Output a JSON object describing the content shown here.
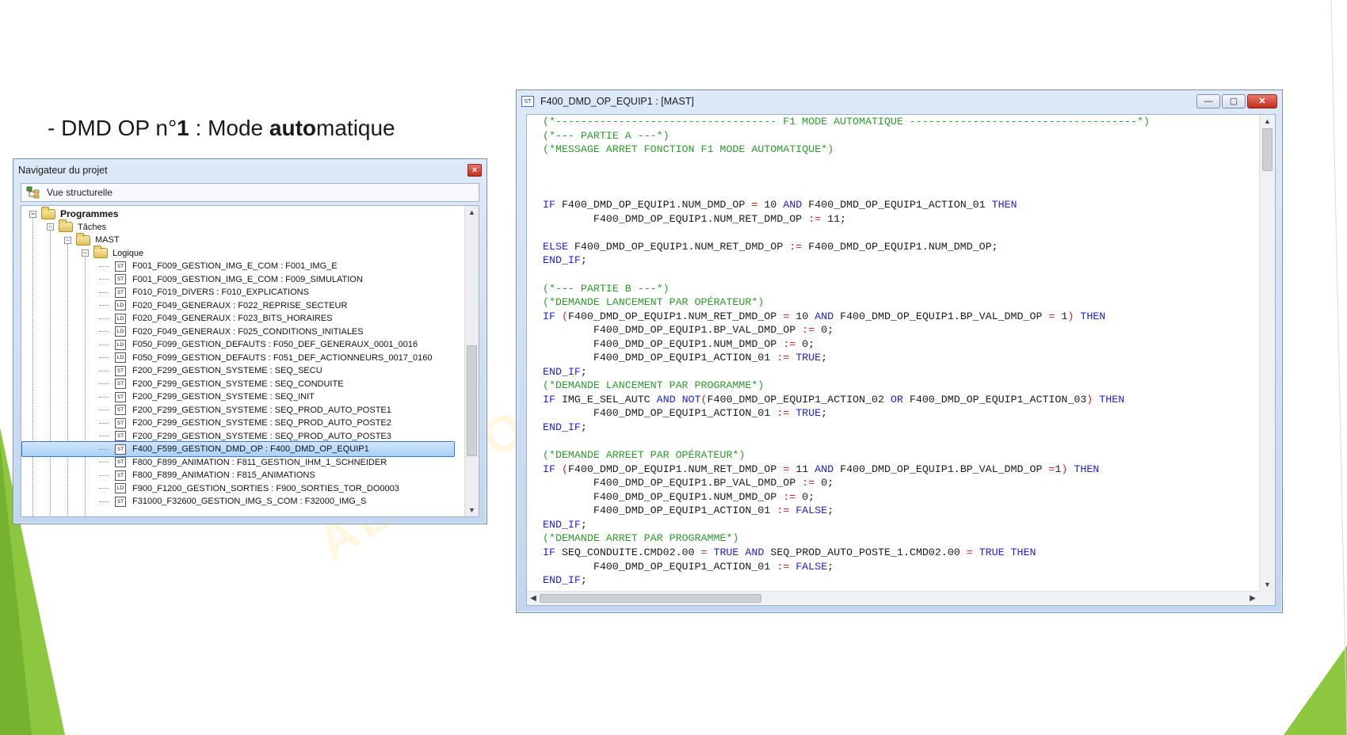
{
  "slide": {
    "title_prefix": "- DMD OP n°",
    "title_num": "1",
    "title_mid": " : Mode ",
    "title_bold": "auto",
    "title_suffix": "matique",
    "watermark": "AEI · FOR"
  },
  "navigator": {
    "title": "Navigateur du projet",
    "close_glyph": "×",
    "toolbar_label": "Vue structurelle",
    "tree": [
      {
        "level": 0,
        "type": "folder",
        "label": "Programmes",
        "bold": true
      },
      {
        "level": 1,
        "type": "folder",
        "label": "Tâches"
      },
      {
        "level": 2,
        "type": "folder",
        "label": "MAST"
      },
      {
        "level": 3,
        "type": "folder",
        "label": "Logique"
      },
      {
        "level": 4,
        "type": "ST",
        "label": "F001_F009_GESTION_IMG_E_COM : F001_IMG_E"
      },
      {
        "level": 4,
        "type": "ST",
        "label": "F001_F009_GESTION_IMG_E_COM : F009_SIMULATION"
      },
      {
        "level": 4,
        "type": "ST",
        "label": "F010_F019_DIVERS : F010_EXPLICATIONS"
      },
      {
        "level": 4,
        "type": "LD",
        "label": "F020_F049_GENERAUX : F022_REPRISE_SECTEUR"
      },
      {
        "level": 4,
        "type": "LD",
        "label": "F020_F049_GENERAUX : F023_BITS_HORAIRES"
      },
      {
        "level": 4,
        "type": "LD",
        "label": "F020_F049_GENERAUX : F025_CONDITIONS_INITIALES"
      },
      {
        "level": 4,
        "type": "LD",
        "label": "F050_F099_GESTION_DEFAUTS : F050_DEF_GENERAUX_0001_0016"
      },
      {
        "level": 4,
        "type": "LD",
        "label": "F050_F099_GESTION_DEFAUTS : F051_DEF_ACTIONNEURS_0017_0160"
      },
      {
        "level": 4,
        "type": "ST",
        "label": "F200_F299_GESTION_SYSTEME : SEQ_SECU"
      },
      {
        "level": 4,
        "type": "ST",
        "label": "F200_F299_GESTION_SYSTEME : SEQ_CONDUITE"
      },
      {
        "level": 4,
        "type": "ST",
        "label": "F200_F299_GESTION_SYSTEME : SEQ_INIT"
      },
      {
        "level": 4,
        "type": "ST",
        "label": "F200_F299_GESTION_SYSTEME : SEQ_PROD_AUTO_POSTE1"
      },
      {
        "level": 4,
        "type": "ST",
        "label": "F200_F299_GESTION_SYSTEME : SEQ_PROD_AUTO_POSTE2"
      },
      {
        "level": 4,
        "type": "ST",
        "label": "F200_F299_GESTION_SYSTEME : SEQ_PROD_AUTO_POSTE3"
      },
      {
        "level": 4,
        "type": "ST",
        "label": "F400_F599_GESTION_DMD_OP : F400_DMD_OP_EQUIP1",
        "selected": true
      },
      {
        "level": 4,
        "type": "ST",
        "label": "F800_F899_ANIMATION : F811_GESTION_IHM_1_SCHNEIDER"
      },
      {
        "level": 4,
        "type": "ST",
        "label": "F800_F899_ANIMATION : F815_ANIMATIONS"
      },
      {
        "level": 4,
        "type": "LD",
        "label": "F900_F1200_GESTION_SORTIES : F900_SORTIES_TOR_DO0003"
      },
      {
        "level": 4,
        "type": "ST",
        "label": "F31000_F32600_GESTION_IMG_S_COM : F32000_IMG_S"
      }
    ]
  },
  "editor": {
    "icon_text": "ST",
    "title": "F400_DMD_OP_EQUIP1 : [MAST]",
    "minimize_glyph": "—",
    "maximize_glyph": "▢",
    "close_glyph": "✕",
    "code_lines": [
      [
        [
          "cm",
          "(*----------------------------------- F1 MODE AUTOMATIQUE ------------------------------------*)"
        ]
      ],
      [
        [
          "cm",
          "(*--- PARTIE A ---*)"
        ]
      ],
      [
        [
          "cm",
          "(*MESSAGE ARRET FONCTION F1 MODE AUTOMATIQUE*)"
        ]
      ],
      [],
      [],
      [],
      [
        [
          "kw",
          "IF"
        ],
        [
          "nm",
          " F400_DMD_OP_EQUIP1.NUM_DMD_OP "
        ],
        [
          "op",
          "="
        ],
        [
          "nm",
          " 10 "
        ],
        [
          "kw",
          "AND"
        ],
        [
          "nm",
          " F400_DMD_OP_EQUIP1_ACTION_01 "
        ],
        [
          "kw",
          "THEN"
        ]
      ],
      [
        [
          "nm",
          "        F400_DMD_OP_EQUIP1.NUM_RET_DMD_OP "
        ],
        [
          "op",
          ":="
        ],
        [
          "nm",
          " 11;"
        ]
      ],
      [],
      [
        [
          "kw",
          "ELSE"
        ],
        [
          "nm",
          " F400_DMD_OP_EQUIP1.NUM_RET_DMD_OP "
        ],
        [
          "op",
          ":="
        ],
        [
          "nm",
          " F400_DMD_OP_EQUIP1.NUM_DMD_OP;"
        ]
      ],
      [
        [
          "kw",
          "END_IF"
        ],
        [
          "nm",
          ";"
        ]
      ],
      [],
      [
        [
          "cm",
          "(*--- PARTIE B ---*)"
        ]
      ],
      [
        [
          "cm",
          "(*DEMANDE LANCEMENT PAR OPÉRATEUR*)"
        ]
      ],
      [
        [
          "kw",
          "IF"
        ],
        [
          "nm",
          " "
        ],
        [
          "op",
          "("
        ],
        [
          "nm",
          "F400_DMD_OP_EQUIP1.NUM_RET_DMD_OP "
        ],
        [
          "op",
          "="
        ],
        [
          "nm",
          " 10 "
        ],
        [
          "kw",
          "AND"
        ],
        [
          "nm",
          " F400_DMD_OP_EQUIP1.BP_VAL_DMD_OP "
        ],
        [
          "op",
          "="
        ],
        [
          "nm",
          " 1"
        ],
        [
          "op",
          ")"
        ],
        [
          "nm",
          " "
        ],
        [
          "kw",
          "THEN"
        ]
      ],
      [
        [
          "nm",
          "        F400_DMD_OP_EQUIP1.BP_VAL_DMD_OP "
        ],
        [
          "op",
          ":="
        ],
        [
          "nm",
          " 0;"
        ]
      ],
      [
        [
          "nm",
          "        F400_DMD_OP_EQUIP1.NUM_DMD_OP "
        ],
        [
          "op",
          ":="
        ],
        [
          "nm",
          " 0;"
        ]
      ],
      [
        [
          "nm",
          "        F400_DMD_OP_EQUIP1_ACTION_01 "
        ],
        [
          "op",
          ":="
        ],
        [
          "nm",
          " "
        ],
        [
          "kw",
          "TRUE"
        ],
        [
          "nm",
          ";"
        ]
      ],
      [
        [
          "kw",
          "END_IF"
        ],
        [
          "nm",
          ";"
        ]
      ],
      [
        [
          "cm",
          "(*DEMANDE LANCEMENT PAR PROGRAMME*)"
        ]
      ],
      [
        [
          "kw",
          "IF"
        ],
        [
          "nm",
          " IMG_E_SEL_AUTC "
        ],
        [
          "kw",
          "AND"
        ],
        [
          "nm",
          " "
        ],
        [
          "kw",
          "NOT"
        ],
        [
          "op",
          "("
        ],
        [
          "nm",
          "F400_DMD_OP_EQUIP1_ACTION_02 "
        ],
        [
          "kw",
          "OR"
        ],
        [
          "nm",
          " F400_DMD_OP_EQUIP1_ACTION_03"
        ],
        [
          "op",
          ")"
        ],
        [
          "nm",
          " "
        ],
        [
          "kw",
          "THEN"
        ]
      ],
      [
        [
          "nm",
          "        F400_DMD_OP_EQUIP1_ACTION_01 "
        ],
        [
          "op",
          ":="
        ],
        [
          "nm",
          " "
        ],
        [
          "kw",
          "TRUE"
        ],
        [
          "nm",
          ";"
        ]
      ],
      [
        [
          "kw",
          "END_IF"
        ],
        [
          "nm",
          ";"
        ]
      ],
      [],
      [
        [
          "cm",
          "(*DEMANDE ARREET PAR OPÉRATEUR*)"
        ]
      ],
      [
        [
          "kw",
          "IF"
        ],
        [
          "nm",
          " "
        ],
        [
          "op",
          "("
        ],
        [
          "nm",
          "F400_DMD_OP_EQUIP1.NUM_RET_DMD_OP "
        ],
        [
          "op",
          "="
        ],
        [
          "nm",
          " 11 "
        ],
        [
          "kw",
          "AND"
        ],
        [
          "nm",
          " F400_DMD_OP_EQUIP1.BP_VAL_DMD_OP "
        ],
        [
          "op",
          "="
        ],
        [
          "nm",
          "1"
        ],
        [
          "op",
          ")"
        ],
        [
          "nm",
          " "
        ],
        [
          "kw",
          "THEN"
        ]
      ],
      [
        [
          "nm",
          "        F400_DMD_OP_EQUIP1.BP_VAL_DMD_OP "
        ],
        [
          "op",
          ":="
        ],
        [
          "nm",
          " 0;"
        ]
      ],
      [
        [
          "nm",
          "        F400_DMD_OP_EQUIP1.NUM_DMD_OP "
        ],
        [
          "op",
          ":="
        ],
        [
          "nm",
          " 0;"
        ]
      ],
      [
        [
          "nm",
          "        F400_DMD_OP_EQUIP1_ACTION_01 "
        ],
        [
          "op",
          ":="
        ],
        [
          "nm",
          " "
        ],
        [
          "kw",
          "FALSE"
        ],
        [
          "nm",
          ";"
        ]
      ],
      [
        [
          "kw",
          "END_IF"
        ],
        [
          "nm",
          ";"
        ]
      ],
      [
        [
          "cm",
          "(*DEMANDE ARRET PAR PROGRAMME*)"
        ]
      ],
      [
        [
          "kw",
          "IF"
        ],
        [
          "nm",
          " SEQ_CONDUITE.CMD02.00 "
        ],
        [
          "op",
          "="
        ],
        [
          "nm",
          " "
        ],
        [
          "kw",
          "TRUE"
        ],
        [
          "nm",
          " "
        ],
        [
          "kw",
          "AND"
        ],
        [
          "nm",
          " SEQ_PROD_AUTO_POSTE_1.CMD02.00 "
        ],
        [
          "op",
          "="
        ],
        [
          "nm",
          " "
        ],
        [
          "kw",
          "TRUE"
        ],
        [
          "nm",
          " "
        ],
        [
          "kw",
          "THEN"
        ]
      ],
      [
        [
          "nm",
          "        F400_DMD_OP_EQUIP1_ACTION_01 "
        ],
        [
          "op",
          ":="
        ],
        [
          "nm",
          " "
        ],
        [
          "kw",
          "FALSE"
        ],
        [
          "nm",
          ";"
        ]
      ],
      [
        [
          "kw",
          "END_IF"
        ],
        [
          "nm",
          ";"
        ]
      ]
    ]
  },
  "colors": {
    "comment": "#2e9a2e",
    "keyword": "#1f1fd6",
    "operator": "#d81e1e",
    "accent_green": "#8dc63f"
  }
}
